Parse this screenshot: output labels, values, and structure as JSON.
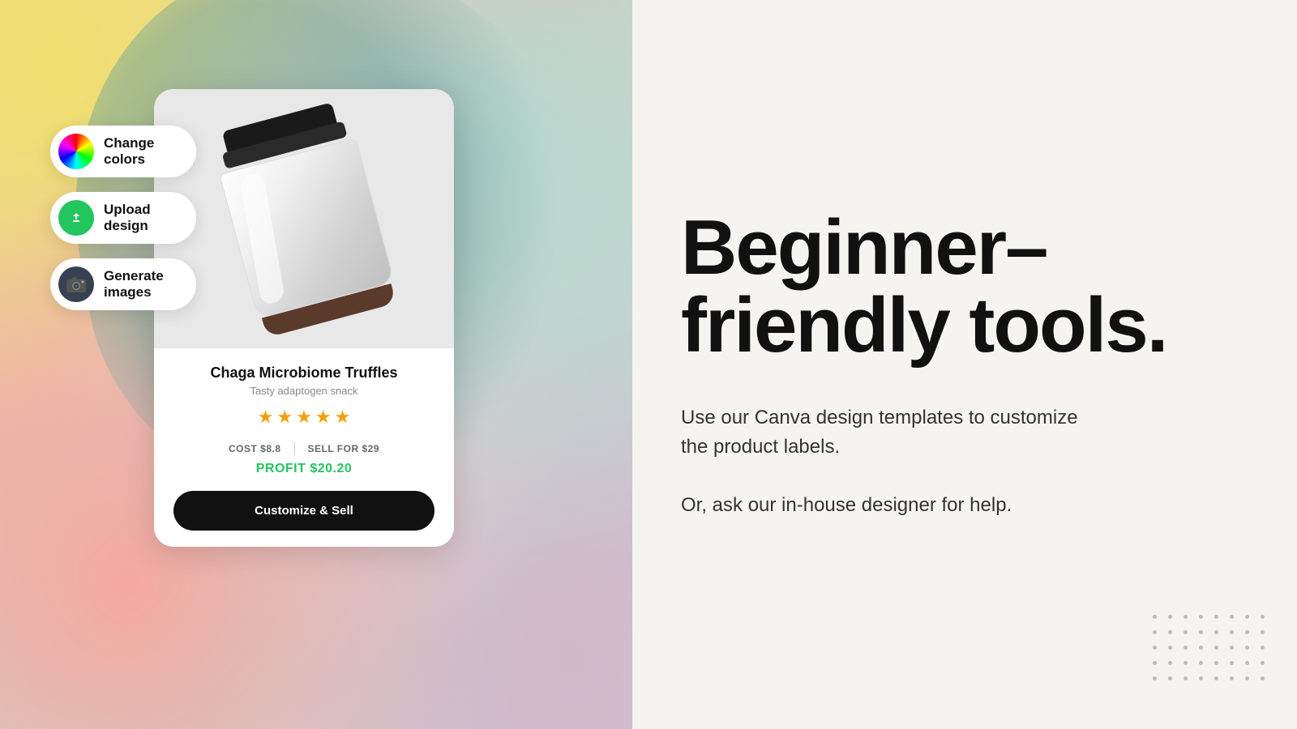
{
  "left": {
    "tools": [
      {
        "id": "change-colors",
        "label": "Change\ncolors",
        "iconType": "colors"
      },
      {
        "id": "upload-design",
        "label": "Upload\ndesign",
        "iconType": "upload"
      },
      {
        "id": "generate-images",
        "label": "Generate\nimages",
        "iconType": "camera"
      }
    ],
    "card": {
      "productName": "Chaga Microbiome Truffles",
      "subtitle": "Tasty adaptogen snack",
      "starCount": 5,
      "costLabel": "COST $8.8",
      "sellLabel": "SELL FOR $29",
      "profitLabel": "PROFIT $20.20",
      "ctaLabel": "Customize & Sell"
    }
  },
  "right": {
    "heading": "Beginner–friendly tools.",
    "description1": "Use our Canva design templates to customize the product labels.",
    "description2": "Or, ask our in-house designer for help."
  }
}
